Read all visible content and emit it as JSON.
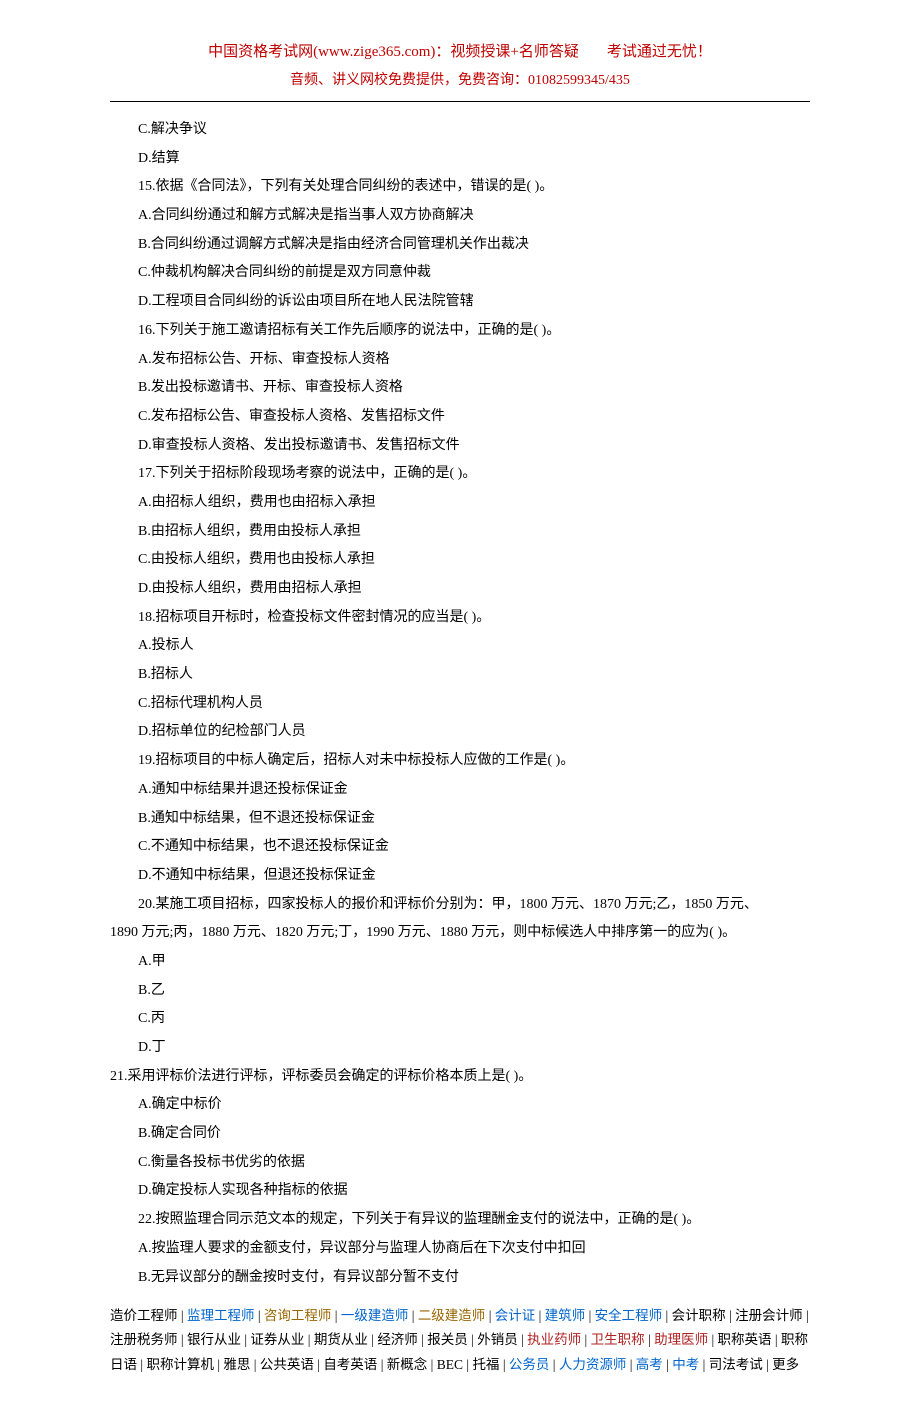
{
  "header": {
    "line1_left": "中国资格考试网(www.zige365.com)：视频授课+名师答疑",
    "line1_right": "考试通过无忧！",
    "line2": "音频、讲义网校免费提供，免费咨询：01082599345/435"
  },
  "body": {
    "l01": "C.解决争议",
    "l02": "D.结算",
    "l03": "15.依据《合同法》，下列有关处理合同纠纷的表述中，错误的是( )。",
    "l04": "A.合同纠纷通过和解方式解决是指当事人双方协商解决",
    "l05": "B.合同纠纷通过调解方式解决是指由经济合同管理机关作出裁决",
    "l06": "C.仲裁机构解决合同纠纷的前提是双方同意仲裁",
    "l07": "D.工程项目合同纠纷的诉讼由项目所在地人民法院管辖",
    "l08": "16.下列关于施工邀请招标有关工作先后顺序的说法中，正确的是( )。",
    "l09": "A.发布招标公告、开标、审查投标人资格",
    "l10": "B.发出投标邀请书、开标、审查投标人资格",
    "l11": "C.发布招标公告、审查投标人资格、发售招标文件",
    "l12": "D.审查投标人资格、发出投标邀请书、发售招标文件",
    "l13": "17.下列关于招标阶段现场考察的说法中，正确的是( )。",
    "l14": "A.由招标人组织，费用也由招标入承担",
    "l15": "B.由招标人组织，费用由投标人承担",
    "l16": "C.由投标人组织，费用也由投标人承担",
    "l17": "D.由投标人组织，费用由招标人承担",
    "l18": "18.招标项目开标时，检查投标文件密封情况的应当是( )。",
    "l19": "A.投标人",
    "l20": "B.招标人",
    "l21": "C.招标代理机构人员",
    "l22": "D.招标单位的纪检部门人员",
    "l23": "19.招标项目的中标人确定后，招标人对未中标投标人应做的工作是( )。",
    "l24": "A.通知中标结果并退还投标保证金",
    "l25": "B.通知中标结果，但不退还投标保证金",
    "l26": "C.不通知中标结果，也不退还投标保证金",
    "l27": "D.不通知中标结果，但退还投标保证金",
    "l28a": "20.某施工项目招标，四家投标人的报价和评标价分别为：甲，1800 万元、1870 万元;乙，1850 万元、",
    "l28b": "1890 万元;丙，1880 万元、1820 万元;丁，1990 万元、1880 万元，则中标候选人中排序第一的应为( )。",
    "l29": "A.甲",
    "l30": "B.乙",
    "l31": "C.丙",
    "l32": "D.丁",
    "l33": "21.采用评标价法进行评标，评标委员会确定的评标价格本质上是( )。",
    "l34": "A.确定中标价",
    "l35": "B.确定合同价",
    "l36": "C.衡量各投标书优劣的依据",
    "l37": "D.确定投标人实现各种指标的依据",
    "l38": "22.按照监理合同示范文本的规定，下列关于有异议的监理酬金支付的说法中，正确的是( )。",
    "l39": "A.按监理人要求的金额支付，异议部分与监理人协商后在下次支付中扣回",
    "l40": "B.无异议部分的酬金按时支付，有异议部分暂不支付"
  },
  "footer": {
    "tokens": [
      {
        "t": "造价工程师",
        "c": ""
      },
      {
        "t": " | ",
        "c": "sep"
      },
      {
        "t": "监理工程师",
        "c": "blue"
      },
      {
        "t": " | ",
        "c": "sep"
      },
      {
        "t": "咨询工程师",
        "c": "brown"
      },
      {
        "t": " | ",
        "c": "sep"
      },
      {
        "t": "一级建造师",
        "c": "blue"
      },
      {
        "t": " | ",
        "c": "sep"
      },
      {
        "t": "二级建造师",
        "c": "brown"
      },
      {
        "t": " | ",
        "c": "sep"
      },
      {
        "t": "会计证",
        "c": "blue"
      },
      {
        "t": " | ",
        "c": "sep"
      },
      {
        "t": "建筑师",
        "c": "blue"
      },
      {
        "t": " | ",
        "c": "sep"
      },
      {
        "t": "安全工程师",
        "c": "blue"
      },
      {
        "t": " | ",
        "c": "sep"
      },
      {
        "t": "会计职称",
        "c": ""
      },
      {
        "t": " | ",
        "c": "sep"
      },
      {
        "t": "注册会计师",
        "c": ""
      },
      {
        "t": " | ",
        "c": "sep"
      },
      {
        "t": "注册税务师",
        "c": ""
      },
      {
        "t": " | ",
        "c": "sep"
      },
      {
        "t": "银行从业",
        "c": ""
      },
      {
        "t": " | ",
        "c": "sep"
      },
      {
        "t": "证券从业",
        "c": ""
      },
      {
        "t": " | ",
        "c": "sep"
      },
      {
        "t": "期货从业",
        "c": ""
      },
      {
        "t": " | ",
        "c": "sep"
      },
      {
        "t": "经济师",
        "c": ""
      },
      {
        "t": " | ",
        "c": "sep"
      },
      {
        "t": "报关员",
        "c": ""
      },
      {
        "t": " | ",
        "c": "sep"
      },
      {
        "t": "外销员",
        "c": ""
      },
      {
        "t": " | ",
        "c": "sep"
      },
      {
        "t": "执业药师",
        "c": "darkred"
      },
      {
        "t": " | ",
        "c": "sep"
      },
      {
        "t": "卫生职称",
        "c": "darkred"
      },
      {
        "t": " | ",
        "c": "sep"
      },
      {
        "t": "助理医师",
        "c": "darkred"
      },
      {
        "t": " | ",
        "c": "sep"
      },
      {
        "t": "职称英语",
        "c": ""
      },
      {
        "t": " | ",
        "c": "sep"
      },
      {
        "t": "职称日语",
        "c": ""
      },
      {
        "t": " | ",
        "c": "sep"
      },
      {
        "t": "职称计算机",
        "c": ""
      },
      {
        "t": " | ",
        "c": "sep"
      },
      {
        "t": "雅思",
        "c": ""
      },
      {
        "t": " | ",
        "c": "sep"
      },
      {
        "t": "公共英语",
        "c": ""
      },
      {
        "t": " | ",
        "c": "sep"
      },
      {
        "t": "自考英语",
        "c": ""
      },
      {
        "t": " | ",
        "c": "sep"
      },
      {
        "t": "新概念",
        "c": ""
      },
      {
        "t": " | ",
        "c": "sep"
      },
      {
        "t": "BEC",
        "c": ""
      },
      {
        "t": " | ",
        "c": "sep"
      },
      {
        "t": "托福",
        "c": ""
      },
      {
        "t": " | ",
        "c": "sep"
      },
      {
        "t": "公务员",
        "c": "blue"
      },
      {
        "t": " | ",
        "c": "sep"
      },
      {
        "t": "人力资源师",
        "c": "blue"
      },
      {
        "t": " | ",
        "c": "sep"
      },
      {
        "t": "高考",
        "c": "blue"
      },
      {
        "t": " | ",
        "c": "sep"
      },
      {
        "t": "中考",
        "c": "blue"
      },
      {
        "t": " | ",
        "c": "sep"
      },
      {
        "t": "司法考试",
        "c": ""
      },
      {
        "t": " | ",
        "c": "sep"
      },
      {
        "t": "更多",
        "c": ""
      }
    ]
  }
}
